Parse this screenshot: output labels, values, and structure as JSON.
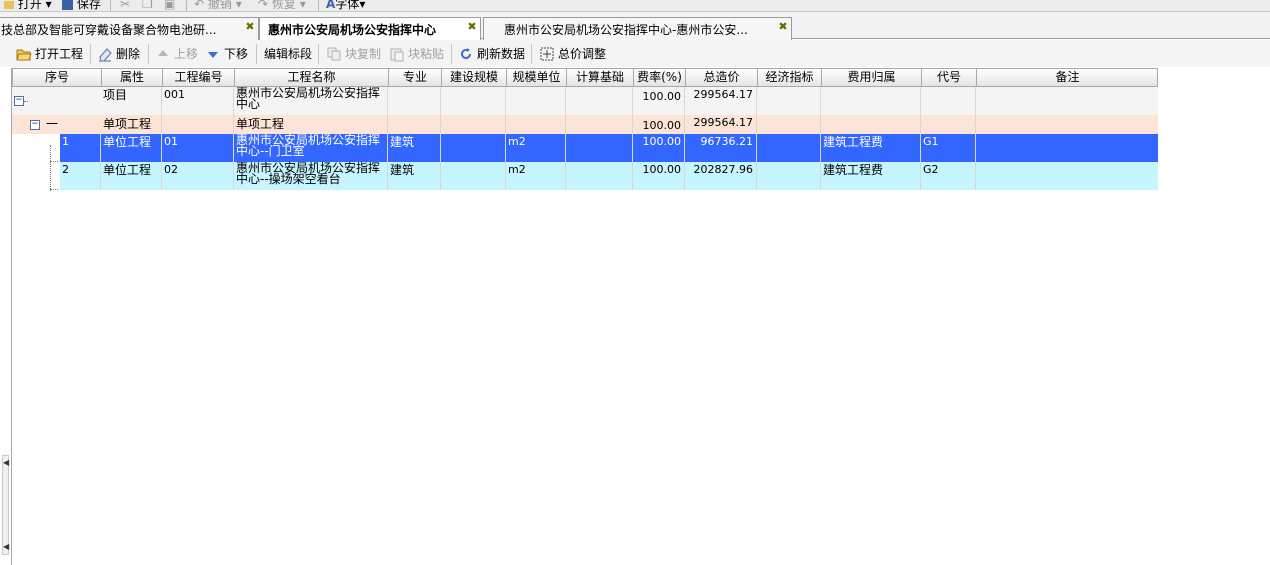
{
  "toolbar_top": {
    "items": [
      {
        "label": "打开",
        "icon": "folder-open-icon",
        "disabled": false
      },
      {
        "label": "保存",
        "icon": "save-icon",
        "disabled": false
      },
      {
        "label": "",
        "icon": "cut-icon",
        "disabled": true
      },
      {
        "label": "",
        "icon": "copy-icon",
        "disabled": true
      },
      {
        "label": "",
        "icon": "paste-icon",
        "disabled": true
      },
      {
        "label": "撤销",
        "icon": "undo-icon",
        "disabled": true
      },
      {
        "label": "恢复",
        "icon": "redo-icon",
        "disabled": true
      },
      {
        "label": "字体",
        "icon": "font-icon",
        "disabled": false
      }
    ]
  },
  "tabs": [
    {
      "label": "技总部及智能可穿戴设备聚合物电池研...",
      "active": false
    },
    {
      "label": "惠州市公安局机场公安指挥中心",
      "active": true
    },
    {
      "label": "惠州市公安局机场公安指挥中心-惠州市公安...",
      "active": false
    }
  ],
  "toolbar": {
    "open_project": "打开工程",
    "delete": "删除",
    "move_up": "上移",
    "move_down": "下移",
    "edit_section": "编辑标段",
    "block_copy": "块复制",
    "block_paste": "块粘贴",
    "refresh": "刷新数据",
    "total_adjust": "总价调整"
  },
  "grid": {
    "columns": [
      "序号",
      "属性",
      "工程编号",
      "工程名称",
      "专业",
      "建设规模",
      "规模单位",
      "计算基础",
      "费率(%)",
      "总造价",
      "经济指标",
      "费用归属",
      "代号",
      "备注"
    ],
    "rows": [
      {
        "seq": "",
        "attr": "项目",
        "code": "001",
        "name": "惠州市公安局机场公安指挥中心",
        "major": "",
        "scale": "",
        "unit": "",
        "base": "",
        "rate": "100.00",
        "total": "299564.17",
        "index": "",
        "cost_owner": "",
        "alias": "",
        "remark": ""
      },
      {
        "seq": "一",
        "attr": "单项工程",
        "code": "",
        "name": "单项工程",
        "major": "",
        "scale": "",
        "unit": "",
        "base": "",
        "rate": "100.00",
        "total": "299564.17",
        "index": "",
        "cost_owner": "",
        "alias": "",
        "remark": ""
      },
      {
        "seq": "1",
        "attr": "单位工程",
        "code": "01",
        "name": "惠州市公安局机场公安指挥中心--门卫室",
        "major": "建筑",
        "scale": "",
        "unit": "m2",
        "base": "",
        "rate": "100.00",
        "total": "96736.21",
        "index": "",
        "cost_owner": "建筑工程费",
        "alias": "G1",
        "remark": ""
      },
      {
        "seq": "2",
        "attr": "单位工程",
        "code": "02",
        "name": "惠州市公安局机场公安指挥中心--操场架空看台",
        "major": "建筑",
        "scale": "",
        "unit": "m2",
        "base": "",
        "rate": "100.00",
        "total": "202827.96",
        "index": "",
        "cost_owner": "建筑工程费",
        "alias": "G2",
        "remark": ""
      }
    ]
  },
  "colors": {
    "selected_row": "#3366ff",
    "item_row": "#fce4d6",
    "alt_row": "#c6f4ff"
  }
}
